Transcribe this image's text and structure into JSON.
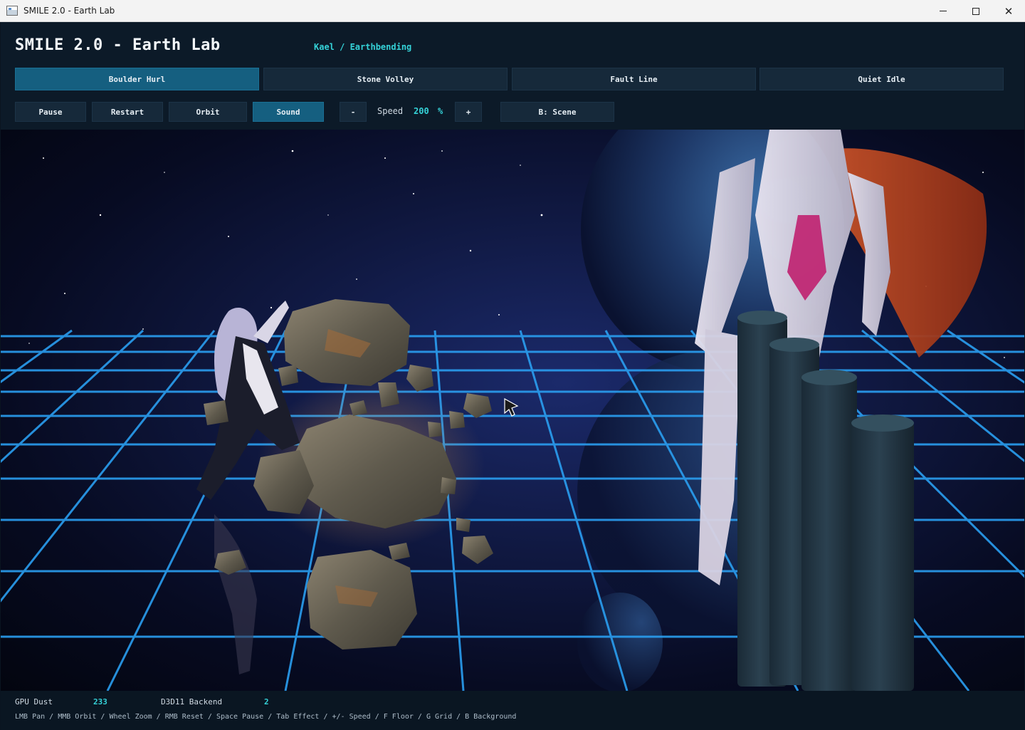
{
  "window": {
    "title": "SMILE 2.0 - Earth Lab",
    "controls": {
      "minimize": "—",
      "maximize": "□",
      "close": "✕"
    }
  },
  "header": {
    "title": "SMILE 2.0 - Earth Lab",
    "subtitle": "Kael / Earthbending"
  },
  "tabs": [
    {
      "label": "Boulder Hurl",
      "active": true
    },
    {
      "label": "Stone Volley",
      "active": false
    },
    {
      "label": "Fault Line",
      "active": false
    },
    {
      "label": "Quiet Idle",
      "active": false
    }
  ],
  "controls": {
    "pause": "Pause",
    "restart": "Restart",
    "orbit": "Orbit",
    "sound": "Sound",
    "minus": "-",
    "speed_label": "Speed",
    "speed_value": "200",
    "speed_unit": "%",
    "plus": "+",
    "background": "B: Scene"
  },
  "stats": {
    "gpu_dust_label": "GPU Dust",
    "gpu_dust_value": "233",
    "backend_label": "D3D11 Backend",
    "backend_value": "2"
  },
  "hints": "LMB Pan / MMB Orbit / Wheel Zoom / RMB Reset / Space Pause / Tab Effect / +/- Speed / F Floor / G Grid / B Background",
  "colors": {
    "accent": "#35d2d8",
    "active_button": "#155f80",
    "button": "#16293a",
    "panel": "#0c1a28",
    "grid": "#2a9ef0",
    "rock": "#6f6a5c",
    "pillar": "#253846"
  }
}
